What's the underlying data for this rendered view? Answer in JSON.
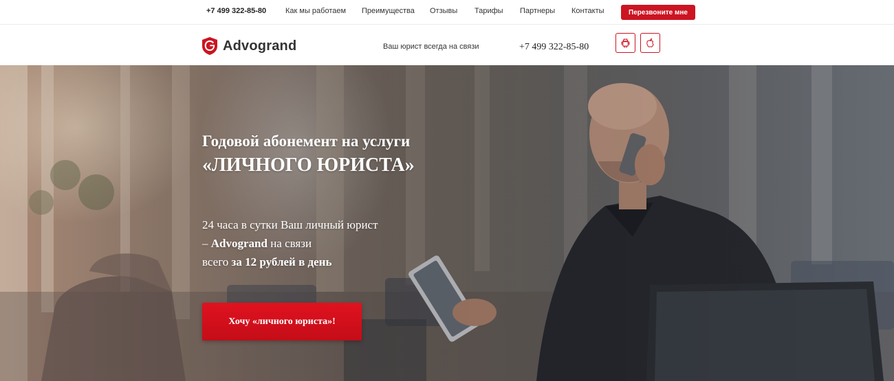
{
  "topnav": {
    "phone": "+7 499 322-85-80",
    "items": [
      "Как мы работаем",
      "Преимущества",
      "Отзывы",
      "Тарифы",
      "Партнеры",
      "Контакты"
    ],
    "callback_button": "Перезвоните мне"
  },
  "header": {
    "logo_text": "Advogrand",
    "tagline": "Ваш юрист всегда на связи",
    "phone": "+7 499 322-85-80",
    "apps": [
      "android-icon",
      "apple-icon"
    ]
  },
  "hero": {
    "title_line1": "Годовой абонемент на услуги",
    "title_line2": "«ЛИЧНОГО ЮРИСТА»",
    "sub_line1": "24 часа в сутки Ваш личный юрист",
    "sub_line2_prefix": "– ",
    "sub_line2_brand": "Advogrand",
    "sub_line2_suffix": " на связи",
    "sub_line3_prefix": "всего ",
    "sub_line3_bold": "за 12 рублей в день",
    "cta": "Хочу «личного юриста»!"
  },
  "colors": {
    "accent": "#cc1422",
    "text": "#333333"
  }
}
